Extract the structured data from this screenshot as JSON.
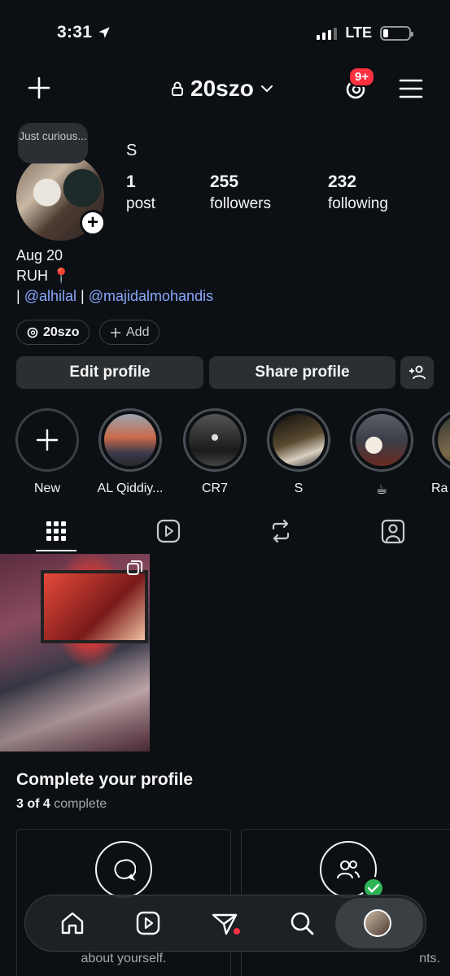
{
  "status_bar": {
    "time": "3:31",
    "carrier": "LTE"
  },
  "header": {
    "username": "20szo",
    "notification_badge": "9+"
  },
  "profile": {
    "note": "Just curious...",
    "name": "S",
    "stats": [
      {
        "value": "1",
        "label": "post"
      },
      {
        "value": "255",
        "label": "followers"
      },
      {
        "value": "232",
        "label": "following"
      }
    ],
    "bio": {
      "line1": "Aug 20",
      "line2": "RUH 📍",
      "prefix": "|",
      "mention1": "@alhilal",
      "separator": "|",
      "mention2": "@majidalmohandis"
    },
    "threads_handle": "20szo",
    "add_label": "Add"
  },
  "buttons": {
    "edit_profile": "Edit profile",
    "share_profile": "Share profile"
  },
  "highlights": [
    {
      "label": "New"
    },
    {
      "label": "AL Qiddiy..."
    },
    {
      "label": "CR7"
    },
    {
      "label": "S"
    },
    {
      "label": "☕"
    },
    {
      "label": "Ra"
    }
  ],
  "complete_profile": {
    "title": "Complete your profile",
    "progress_count": "3 of 4",
    "progress_word": "complete",
    "card1_text": "about yourself.",
    "card2_text": "nts."
  },
  "colors": {
    "background": "#0c1014",
    "button": "#2a2f33",
    "link": "#8aa8ff",
    "badge": "#ff3040"
  }
}
